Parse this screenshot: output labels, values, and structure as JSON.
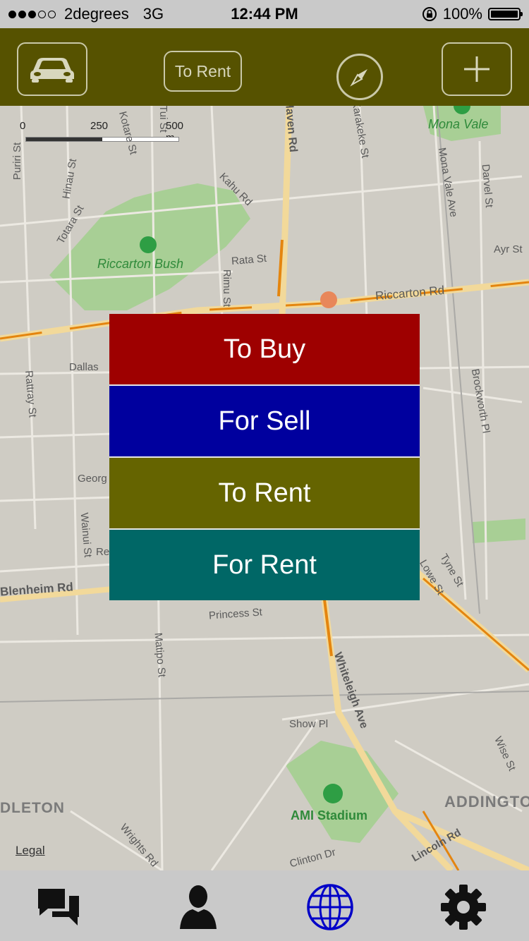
{
  "status_bar": {
    "carrier": "2degrees",
    "network": "3G",
    "time": "12:44 PM",
    "battery": "100%"
  },
  "navbar": {
    "car_icon": "car-icon",
    "rent_label": "To Rent",
    "compass_icon": "compass-icon",
    "add_icon": "plus-icon",
    "color": "#565200"
  },
  "map": {
    "scale": {
      "zero": "0",
      "mid": "250",
      "end": "500 m"
    },
    "parks": [
      "Mona Vale",
      "Riccarton Bush",
      "AMI Stadium"
    ],
    "streets": [
      "Puriri St",
      "Hinau St",
      "Totara St",
      "Kotare St",
      "Tui St",
      "Kahu Rd",
      "Rata St",
      "Rimu St",
      "Riccarton Rd",
      "Dallas",
      "Rattray St",
      "Georg",
      "Wainui St",
      "Blenheim Rd",
      "Princess St",
      "Matipo St",
      "Whiteleigh Ave",
      "Show Pl",
      "Wrights Rd",
      "Clinton Dr",
      "Lincoln Rd",
      "Wise St",
      "Tyne St",
      "Lowe St",
      "Brockworth Pl",
      "Darvel St",
      "Mona Vale Ave",
      "Ayr St",
      "Karakeke St",
      "Haven Rd",
      "Re"
    ],
    "areas": [
      "DLETON",
      "ADDINGTO"
    ],
    "legal": "Legal"
  },
  "menu": {
    "items": [
      {
        "label": "To Buy",
        "color": "#9e0000"
      },
      {
        "label": "For Sell",
        "color": "#00009e"
      },
      {
        "label": "To Rent",
        "color": "#656400"
      },
      {
        "label": "For Rent",
        "color": "#006766"
      }
    ]
  },
  "tabbar": {
    "tabs": [
      "chat-icon",
      "person-icon",
      "globe-icon",
      "gear-icon"
    ],
    "active": "globe-icon"
  }
}
